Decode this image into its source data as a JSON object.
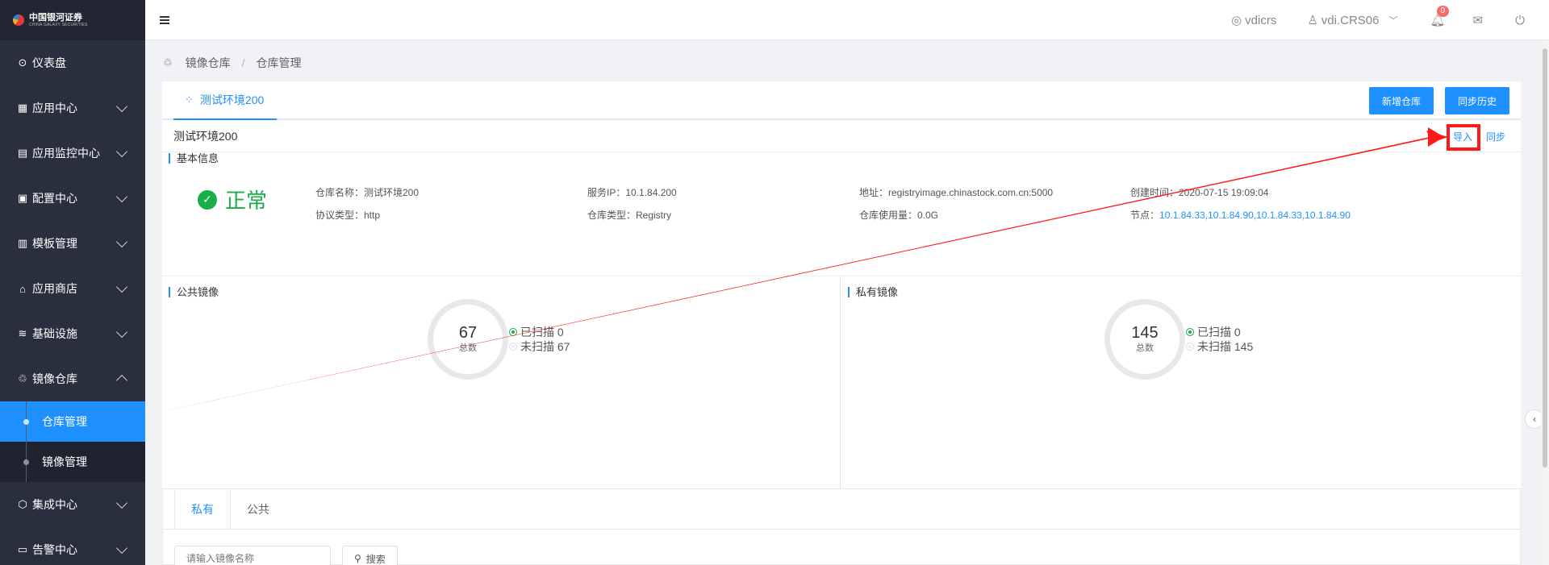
{
  "sidebar": {
    "logo_title": "中国银河证券",
    "logo_sub": "CHINA GALAXY SECURITIES",
    "items": [
      {
        "icon": "dashboard-icon",
        "glyph": "⊙",
        "label": "仪表盘"
      },
      {
        "icon": "grid-icon",
        "glyph": "▦",
        "label": "应用中心"
      },
      {
        "icon": "monitor-icon",
        "glyph": "▤",
        "label": "应用监控中心"
      },
      {
        "icon": "config-icon",
        "glyph": "▣",
        "label": "配置中心"
      },
      {
        "icon": "template-icon",
        "glyph": "▥",
        "label": "模板管理"
      },
      {
        "icon": "store-icon",
        "glyph": "⌂",
        "label": "应用商店"
      },
      {
        "icon": "layers-icon",
        "glyph": "≋",
        "label": "基础设施"
      },
      {
        "icon": "registry-icon",
        "glyph": "♲",
        "label": "镜像仓库"
      },
      {
        "icon": "cube-icon",
        "glyph": "⬡",
        "label": "集成中心"
      },
      {
        "icon": "alert-icon",
        "glyph": "▭",
        "label": "告警中心"
      }
    ],
    "sub_items": [
      {
        "label": "仓库管理"
      },
      {
        "label": "镜像管理"
      }
    ]
  },
  "header": {
    "tenant": "vdicrs",
    "user": "vdi.CRS06",
    "notification_count": "0"
  },
  "breadcrumb": {
    "items": [
      "镜像仓库",
      "仓库管理"
    ]
  },
  "tabs": {
    "active": "测试环境200"
  },
  "buttons": {
    "new_repo": "新增仓库",
    "sync_history": "同步历史",
    "import": "导入",
    "sync": "同步"
  },
  "repo": {
    "name": "测试环境200",
    "basic_info_title": "基本信息",
    "status": "正常",
    "fields": {
      "name": "仓库名称：测试环境200",
      "protocol": "协议类型：http",
      "service_ip": "服务IP：10.1.84.200",
      "repo_type": "仓库类型：Registry",
      "address": "地址：registryimage.chinastock.com.cn:5000",
      "usage": "仓库使用量：0.0G",
      "created": "创建时间：2020-07-15 19:09:04",
      "nodes_label": "节点：",
      "nodes_value": "10.1.84.33,10.1.84.90,10.1.84.33,10.1.84.90"
    }
  },
  "public_images": {
    "title": "公共镜像",
    "total": "67",
    "total_label": "总数",
    "scanned": "已扫描 0",
    "unscanned": "未扫描 67"
  },
  "private_images": {
    "title": "私有镜像",
    "total": "145",
    "total_label": "总数",
    "scanned": "已扫描 0",
    "unscanned": "未扫描 145"
  },
  "image_list": {
    "tab_private": "私有",
    "tab_public": "公共",
    "search_placeholder": "请输入镜像名称",
    "search_button": "搜索"
  },
  "colors": {
    "accent": "#1e90ff",
    "success": "#1aad49",
    "annotation": "#ff1a1a",
    "sidebar_bg": "#2a2f3e"
  }
}
